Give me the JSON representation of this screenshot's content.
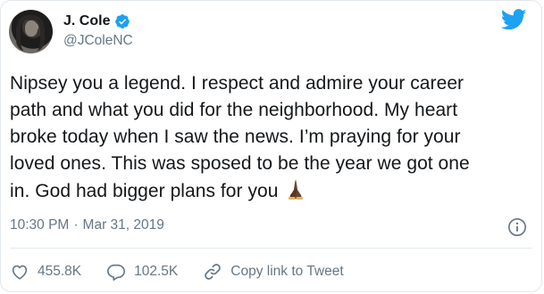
{
  "author": {
    "display_name": "J. Cole",
    "handle": "@JColeNC"
  },
  "tweet": {
    "lines": [
      "Nipsey you a legend. I respect and admire your career",
      "path and what you did for the neighborhood. My heart",
      "broke today when I saw the news. I’m praying for your",
      "loved ones. This was sposed to be the year we got one",
      "in. God had bigger plans for you"
    ],
    "emoji": "folded-hands"
  },
  "meta": {
    "time": "10:30 PM",
    "separator": "·",
    "date": "Mar 31, 2019"
  },
  "actions": {
    "likes": "455.8K",
    "replies": "102.5K",
    "copy_link": "Copy link to Tweet"
  },
  "colors": {
    "brand": "#1da1f2",
    "secondary_text": "#657786",
    "primary_text": "#14171a",
    "border": "#e1e8ed"
  }
}
